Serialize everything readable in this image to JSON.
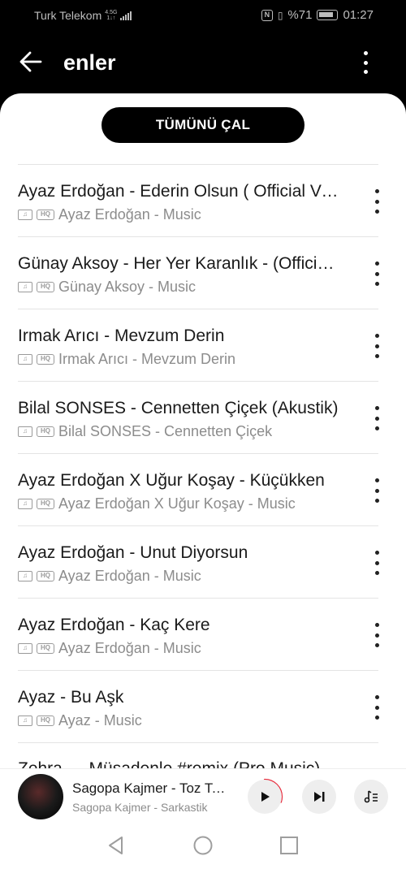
{
  "status": {
    "carrier": "Turk Telekom",
    "net_top": "4.5G",
    "net_bottom": "1↓↑",
    "battery": "%71",
    "time": "01:27"
  },
  "header": {
    "title": "enler",
    "back_icon": "arrow-left-icon",
    "more_icon": "vertical-dots-icon"
  },
  "play_all_label": "TÜMÜNÜ ÇAL",
  "badges": {
    "hq": "HQ"
  },
  "songs": [
    {
      "title": "Ayaz Erdoğan - Ederin Olsun ( Official Video )",
      "subtitle": "Ayaz Erdoğan - Music"
    },
    {
      "title": "Günay Aksoy - Her Yer Karanlık - (Official Video)",
      "subtitle": "Günay Aksoy - Music"
    },
    {
      "title": "Irmak Arıcı - Mevzum Derin",
      "subtitle": "Irmak Arıcı - Mevzum Derin"
    },
    {
      "title": "Bilal SONSES - Cennetten Çiçek (Akustik)",
      "subtitle": "Bilal SONSES - Cennetten Çiçek"
    },
    {
      "title": "Ayaz Erdoğan X Uğur Koşay - Küçükken",
      "subtitle": "Ayaz Erdoğan X Uğur Koşay - Music"
    },
    {
      "title": "Ayaz Erdoğan - Unut Diyorsun",
      "subtitle": "Ayaz Erdoğan - Music"
    },
    {
      "title": "Ayaz Erdoğan - Kaç Kere",
      "subtitle": "Ayaz Erdoğan - Music"
    },
    {
      "title": "Ayaz - Bu Aşk",
      "subtitle": "Ayaz - Music"
    },
    {
      "title": "Zehra — Müsadenle #remix (Pro Music)",
      "subtitle": ""
    }
  ],
  "now_playing": {
    "title": "Sagopa Kajmer - Toz Taneleri",
    "subtitle": "Sagopa Kajmer - Sarkastik",
    "progress": 0.3
  },
  "colors": {
    "accent": "#e8293a",
    "header_bg": "#000000",
    "sheet_bg": "#ffffff"
  }
}
